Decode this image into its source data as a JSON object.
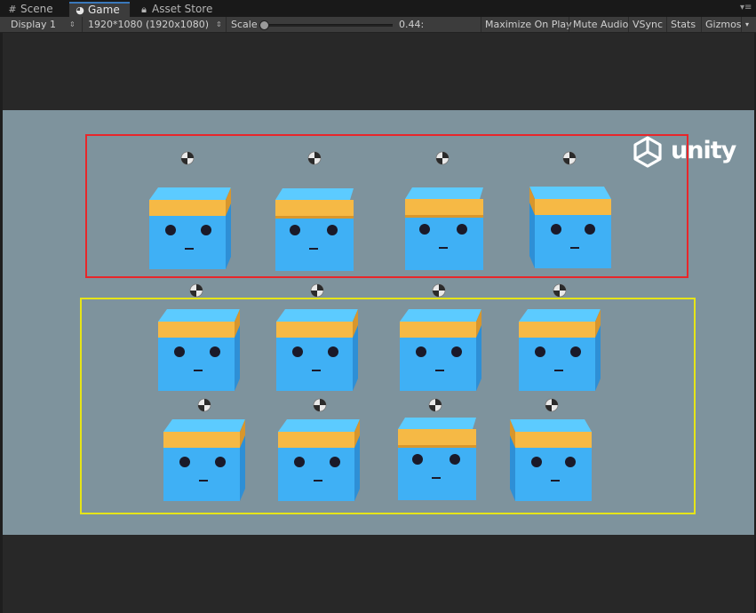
{
  "tabs": [
    {
      "label": "Scene",
      "icon": "grid-icon",
      "active": false
    },
    {
      "label": "Game",
      "icon": "pacman-icon",
      "active": true
    },
    {
      "label": "Asset Store",
      "icon": "lock-icon",
      "active": false
    }
  ],
  "toolbar": {
    "display": "Display 1",
    "resolution": "1920*1080 (1920x1080)",
    "scale_label": "Scale",
    "scale_value": "0.44:",
    "scale_fraction": 0.02,
    "maximize": "Maximize On Play",
    "mute": "Mute Audio",
    "vsync": "VSync",
    "stats": "Stats",
    "gizmos": "Gizmos"
  },
  "viewport": {
    "background": "#7e939d",
    "logo_text": "unity",
    "red_group_border": "#e8262a",
    "yellow_group_border": "#e6e418",
    "cube_color": "#3fb0f5",
    "band_color": "#f6b945",
    "red_group_count": 4,
    "yellow_group_count": 8
  }
}
